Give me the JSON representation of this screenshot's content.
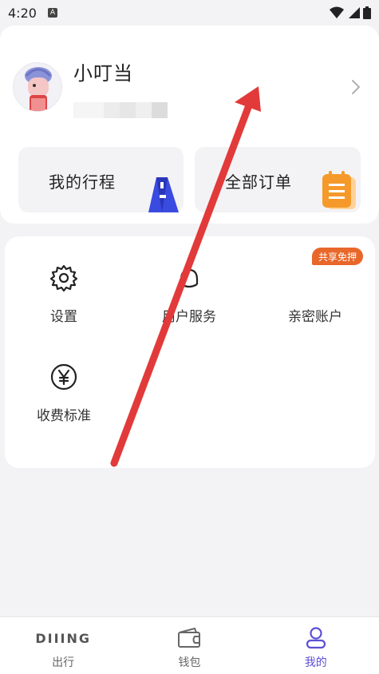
{
  "status_bar": {
    "time": "4:20",
    "notif": "A"
  },
  "profile": {
    "name": "小叮当",
    "chevron_icon": "chevron-right-icon"
  },
  "quick_actions": [
    {
      "label": "我的行程",
      "icon": "road-icon"
    },
    {
      "label": "全部订单",
      "icon": "clipboard-icon"
    }
  ],
  "services": [
    {
      "label": "设置",
      "icon": "gear-icon"
    },
    {
      "label": "用户服务",
      "icon": "headset-icon"
    },
    {
      "label": "亲密账户",
      "icon": "family-icon"
    },
    {
      "label": "收费标准",
      "icon": "yen-icon"
    }
  ],
  "promo_badge": "共享免押",
  "bottom_nav": [
    {
      "label": "出行",
      "brand": "DIIING",
      "icon": "brand-logo"
    },
    {
      "label": "钱包",
      "icon": "wallet-icon"
    },
    {
      "label": "我的",
      "icon": "user-icon",
      "active": true
    }
  ],
  "colors": {
    "accent": "#5b4fd6",
    "promo": "#e8672a",
    "arrow": "#e23a3a"
  }
}
